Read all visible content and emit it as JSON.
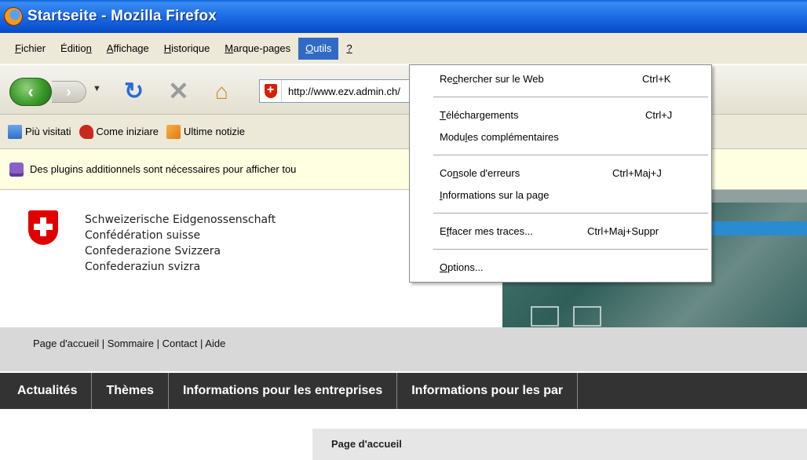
{
  "window": {
    "title": "Startseite - Mozilla Firefox"
  },
  "menubar": {
    "items": [
      {
        "pre": "",
        "u": "F",
        "post": "ichier"
      },
      {
        "pre": "Éditio",
        "u": "n",
        "post": ""
      },
      {
        "pre": "",
        "u": "A",
        "post": "ffichage"
      },
      {
        "pre": "",
        "u": "H",
        "post": "istorique"
      },
      {
        "pre": "",
        "u": "M",
        "post": "arque-pages"
      },
      {
        "pre": "",
        "u": "O",
        "post": "utils"
      },
      {
        "pre": "",
        "u": "?",
        "post": ""
      }
    ]
  },
  "navbar": {
    "url": "http://www.ezv.admin.ch/"
  },
  "bookmarks": [
    {
      "label": "Più visitati",
      "icon": "most-visited-icon"
    },
    {
      "label": "Come iniziare",
      "icon": "getting-started-icon"
    },
    {
      "label": "Ultime notizie",
      "icon": "rss-icon"
    }
  ],
  "notification": {
    "text": "Des plugins additionnels sont nécessaires pour afficher tou"
  },
  "page": {
    "confederation": [
      "Schweizerische Eidgenossenschaft",
      "Confédération suisse",
      "Confederazione Svizzera",
      "Confederaziun svizra"
    ],
    "utility_links": "Page d'accueil | Sommaire | Contact | Aide",
    "main_nav": [
      "Actualités",
      "Thèmes",
      "Informations pour les entreprises",
      "Informations pour les par"
    ],
    "breadcrumb": "Page d'accueil"
  },
  "tools_menu": {
    "items": [
      {
        "pre": "Re",
        "u": "c",
        "post": "hercher sur le Web",
        "shortcut": "Ctrl+K"
      },
      {
        "pre": "",
        "u": "T",
        "post": "éléchargements",
        "shortcut": "Ctrl+J"
      },
      {
        "pre": "Modu",
        "u": "l",
        "post": "es complémentaires",
        "shortcut": ""
      },
      {
        "pre": "Co",
        "u": "n",
        "post": "sole d'erreurs",
        "shortcut": "Ctrl+Maj+J"
      },
      {
        "pre": "",
        "u": "I",
        "post": "nformations sur la page",
        "shortcut": ""
      },
      {
        "pre": "E",
        "u": "f",
        "post": "facer mes traces...",
        "shortcut": "Ctrl+Maj+Suppr"
      },
      {
        "pre": "",
        "u": "O",
        "post": "ptions...",
        "shortcut": ""
      }
    ]
  }
}
